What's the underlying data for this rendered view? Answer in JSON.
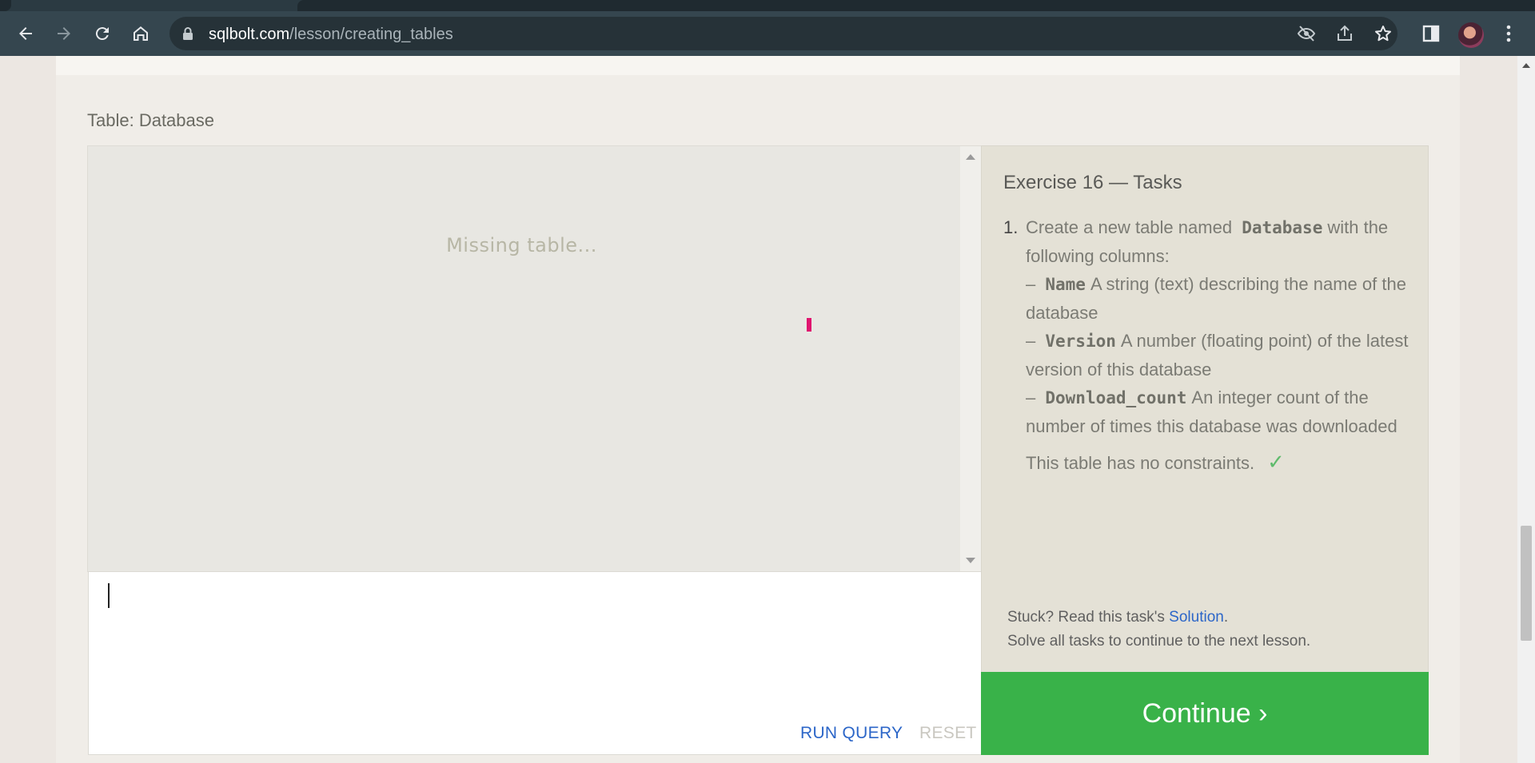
{
  "browser": {
    "url_host": "sqlbolt.com",
    "url_path": "/lesson/creating_tables",
    "icons": [
      "back-icon",
      "forward-icon",
      "reload-icon",
      "home-icon",
      "lock-icon",
      "eye-off-icon",
      "share-icon",
      "star-icon",
      "side-panel-icon",
      "avatar",
      "menu-icon"
    ]
  },
  "exercise": {
    "table_label": "Table: Database",
    "results_placeholder": "Missing table...",
    "run_query_label": "RUN QUERY",
    "reset_label": "RESET",
    "tasks_title": "Exercise 16 — Tasks",
    "task_number": "1.",
    "task": {
      "intro_before": "Create a new table named",
      "table_name": "Database",
      "intro_after": "with the following columns:",
      "columns": [
        {
          "dash": "–",
          "name": "Name",
          "description": "A string (text) describing the name of the database"
        },
        {
          "dash": "–",
          "name": "Version",
          "description": "A number (floating point) of the latest version of this database"
        },
        {
          "dash": "–",
          "name": "Download_count",
          "description": "An integer count of the number of times this database was downloaded"
        }
      ],
      "constraints_note": "This table has no constraints.",
      "check_mark": "✓"
    },
    "stuck_text": "Stuck? Read this task's",
    "solution_link": "Solution",
    "period": ".",
    "solve_all_text": "Solve all tasks to continue to the next lesson.",
    "continue_label": "Continue ›"
  },
  "colors": {
    "accent_green": "#39b249",
    "link_blue": "#2c66c8",
    "highlight_pink": "#e0156f"
  }
}
